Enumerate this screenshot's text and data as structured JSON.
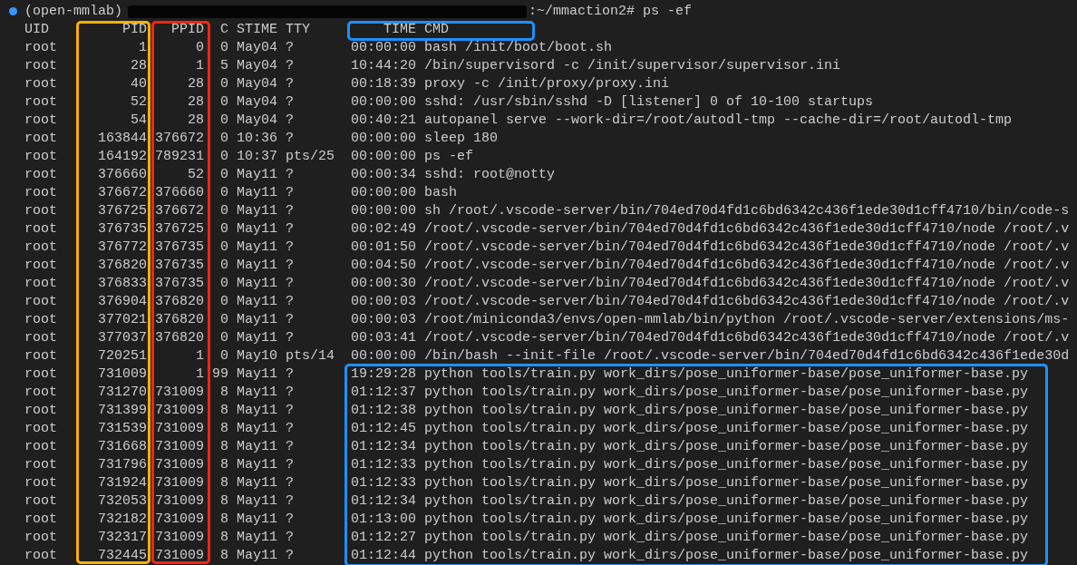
{
  "prompt": {
    "env": "(open-mmlab)",
    "redacted": true,
    "path": ":~/mmaction2#",
    "command": "ps -ef"
  },
  "columns": {
    "uid": "UID",
    "pid": "PID",
    "ppid": "PPID",
    "c": "C",
    "stime": "STIME",
    "tty": "TTY",
    "time": "TIME",
    "cmd": "CMD"
  },
  "rows": [
    {
      "uid": "root",
      "pid": "1",
      "ppid": "0",
      "c": "0",
      "stime": "May04",
      "tty": "?",
      "time": "00:00:00",
      "cmd": "bash /init/boot/boot.sh",
      "framed": false
    },
    {
      "uid": "root",
      "pid": "28",
      "ppid": "1",
      "c": "5",
      "stime": "May04",
      "tty": "?",
      "time": "10:44:20",
      "cmd": "/bin/supervisord -c /init/supervisor/supervisor.ini",
      "framed": false
    },
    {
      "uid": "root",
      "pid": "40",
      "ppid": "28",
      "c": "0",
      "stime": "May04",
      "tty": "?",
      "time": "00:18:39",
      "cmd": "proxy -c /init/proxy/proxy.ini",
      "framed": false
    },
    {
      "uid": "root",
      "pid": "52",
      "ppid": "28",
      "c": "0",
      "stime": "May04",
      "tty": "?",
      "time": "00:00:00",
      "cmd": "sshd: /usr/sbin/sshd -D [listener] 0 of 10-100 startups",
      "framed": false
    },
    {
      "uid": "root",
      "pid": "54",
      "ppid": "28",
      "c": "0",
      "stime": "May04",
      "tty": "?",
      "time": "00:40:21",
      "cmd": "autopanel serve --work-dir=/root/autodl-tmp --cache-dir=/root/autodl-tmp",
      "framed": false
    },
    {
      "uid": "root",
      "pid": "163844",
      "ppid": "376672",
      "c": "0",
      "stime": "10:36",
      "tty": "?",
      "time": "00:00:00",
      "cmd": "sleep 180",
      "framed": false
    },
    {
      "uid": "root",
      "pid": "164192",
      "ppid": "789231",
      "c": "0",
      "stime": "10:37",
      "tty": "pts/25",
      "time": "00:00:00",
      "cmd": "ps -ef",
      "framed": false
    },
    {
      "uid": "root",
      "pid": "376660",
      "ppid": "52",
      "c": "0",
      "stime": "May11",
      "tty": "?",
      "time": "00:00:34",
      "cmd": "sshd: root@notty",
      "framed": false
    },
    {
      "uid": "root",
      "pid": "376672",
      "ppid": "376660",
      "c": "0",
      "stime": "May11",
      "tty": "?",
      "time": "00:00:00",
      "cmd": "bash",
      "framed": false
    },
    {
      "uid": "root",
      "pid": "376725",
      "ppid": "376672",
      "c": "0",
      "stime": "May11",
      "tty": "?",
      "time": "00:00:00",
      "cmd": "sh /root/.vscode-server/bin/704ed70d4fd1c6bd6342c436f1ede30d1cff4710/bin/code-s",
      "framed": false
    },
    {
      "uid": "root",
      "pid": "376735",
      "ppid": "376725",
      "c": "0",
      "stime": "May11",
      "tty": "?",
      "time": "00:02:49",
      "cmd": "/root/.vscode-server/bin/704ed70d4fd1c6bd6342c436f1ede30d1cff4710/node /root/.v",
      "framed": false
    },
    {
      "uid": "root",
      "pid": "376772",
      "ppid": "376735",
      "c": "0",
      "stime": "May11",
      "tty": "?",
      "time": "00:01:50",
      "cmd": "/root/.vscode-server/bin/704ed70d4fd1c6bd6342c436f1ede30d1cff4710/node /root/.v",
      "framed": false
    },
    {
      "uid": "root",
      "pid": "376820",
      "ppid": "376735",
      "c": "0",
      "stime": "May11",
      "tty": "?",
      "time": "00:04:50",
      "cmd": "/root/.vscode-server/bin/704ed70d4fd1c6bd6342c436f1ede30d1cff4710/node /root/.v",
      "framed": false
    },
    {
      "uid": "root",
      "pid": "376833",
      "ppid": "376735",
      "c": "0",
      "stime": "May11",
      "tty": "?",
      "time": "00:00:30",
      "cmd": "/root/.vscode-server/bin/704ed70d4fd1c6bd6342c436f1ede30d1cff4710/node /root/.v",
      "framed": false
    },
    {
      "uid": "root",
      "pid": "376904",
      "ppid": "376820",
      "c": "0",
      "stime": "May11",
      "tty": "?",
      "time": "00:00:03",
      "cmd": "/root/.vscode-server/bin/704ed70d4fd1c6bd6342c436f1ede30d1cff4710/node /root/.v",
      "framed": false
    },
    {
      "uid": "root",
      "pid": "377021",
      "ppid": "376820",
      "c": "0",
      "stime": "May11",
      "tty": "?",
      "time": "00:00:03",
      "cmd": "/root/miniconda3/envs/open-mmlab/bin/python /root/.vscode-server/extensions/ms-",
      "framed": false
    },
    {
      "uid": "root",
      "pid": "377037",
      "ppid": "376820",
      "c": "0",
      "stime": "May11",
      "tty": "?",
      "time": "00:03:41",
      "cmd": "/root/.vscode-server/bin/704ed70d4fd1c6bd6342c436f1ede30d1cff4710/node /root/.v",
      "framed": false
    },
    {
      "uid": "root",
      "pid": "720251",
      "ppid": "1",
      "c": "0",
      "stime": "May10",
      "tty": "pts/14",
      "time": "00:00:00",
      "cmd": "/bin/bash --init-file /root/.vscode-server/bin/704ed70d4fd1c6bd6342c436f1ede30d",
      "framed": false
    },
    {
      "uid": "root",
      "pid": "731009",
      "ppid": "1",
      "c": "99",
      "stime": "May11",
      "tty": "?",
      "time": "19:29:28",
      "cmd": "python tools/train.py work_dirs/pose_uniformer-base/pose_uniformer-base.py",
      "framed": true
    },
    {
      "uid": "root",
      "pid": "731270",
      "ppid": "731009",
      "c": "8",
      "stime": "May11",
      "tty": "?",
      "time": "01:12:37",
      "cmd": "python tools/train.py work_dirs/pose_uniformer-base/pose_uniformer-base.py",
      "framed": true
    },
    {
      "uid": "root",
      "pid": "731399",
      "ppid": "731009",
      "c": "8",
      "stime": "May11",
      "tty": "?",
      "time": "01:12:38",
      "cmd": "python tools/train.py work_dirs/pose_uniformer-base/pose_uniformer-base.py",
      "framed": true
    },
    {
      "uid": "root",
      "pid": "731539",
      "ppid": "731009",
      "c": "8",
      "stime": "May11",
      "tty": "?",
      "time": "01:12:45",
      "cmd": "python tools/train.py work_dirs/pose_uniformer-base/pose_uniformer-base.py",
      "framed": true
    },
    {
      "uid": "root",
      "pid": "731668",
      "ppid": "731009",
      "c": "8",
      "stime": "May11",
      "tty": "?",
      "time": "01:12:34",
      "cmd": "python tools/train.py work_dirs/pose_uniformer-base/pose_uniformer-base.py",
      "framed": true
    },
    {
      "uid": "root",
      "pid": "731796",
      "ppid": "731009",
      "c": "8",
      "stime": "May11",
      "tty": "?",
      "time": "01:12:33",
      "cmd": "python tools/train.py work_dirs/pose_uniformer-base/pose_uniformer-base.py",
      "framed": true
    },
    {
      "uid": "root",
      "pid": "731924",
      "ppid": "731009",
      "c": "8",
      "stime": "May11",
      "tty": "?",
      "time": "01:12:33",
      "cmd": "python tools/train.py work_dirs/pose_uniformer-base/pose_uniformer-base.py",
      "framed": true
    },
    {
      "uid": "root",
      "pid": "732053",
      "ppid": "731009",
      "c": "8",
      "stime": "May11",
      "tty": "?",
      "time": "01:12:34",
      "cmd": "python tools/train.py work_dirs/pose_uniformer-base/pose_uniformer-base.py",
      "framed": true
    },
    {
      "uid": "root",
      "pid": "732182",
      "ppid": "731009",
      "c": "8",
      "stime": "May11",
      "tty": "?",
      "time": "01:13:00",
      "cmd": "python tools/train.py work_dirs/pose_uniformer-base/pose_uniformer-base.py",
      "framed": true
    },
    {
      "uid": "root",
      "pid": "732317",
      "ppid": "731009",
      "c": "8",
      "stime": "May11",
      "tty": "?",
      "time": "01:12:27",
      "cmd": "python tools/train.py work_dirs/pose_uniformer-base/pose_uniformer-base.py",
      "framed": true
    },
    {
      "uid": "root",
      "pid": "732445",
      "ppid": "731009",
      "c": "8",
      "stime": "May11",
      "tty": "?",
      "time": "01:12:44",
      "cmd": "python tools/train.py work_dirs/pose_uniformer-base/pose_uniformer-base.py",
      "framed": true
    }
  ],
  "frames": [
    {
      "kind": "pid-column",
      "color": "#ffb000"
    },
    {
      "kind": "ppid-column",
      "color": "#ff2410"
    },
    {
      "kind": "time-cmd-header",
      "color": "#1e90ff"
    },
    {
      "kind": "framed-rows",
      "color": "#1e90ff"
    }
  ]
}
